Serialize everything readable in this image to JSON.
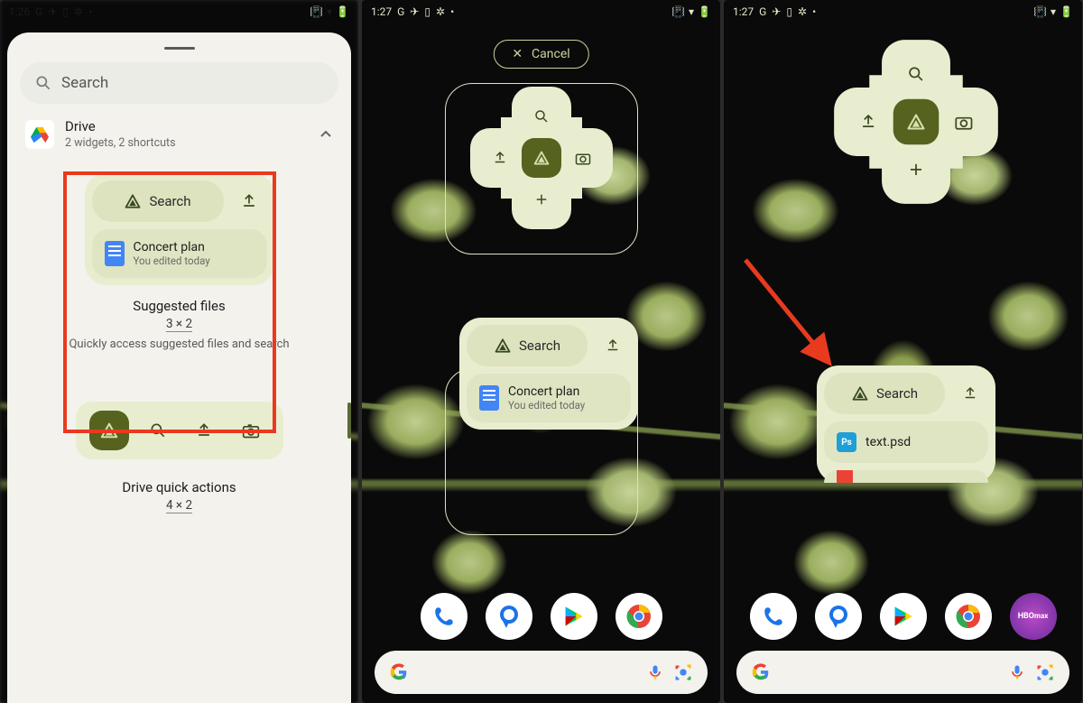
{
  "status": {
    "time_panel1": "1:26",
    "time_panel23": "1:27"
  },
  "panel1": {
    "search_label": "Search",
    "app_title": "Drive",
    "app_subtitle": "2 widgets, 2 shortcuts",
    "widget1": {
      "search_label": "Search",
      "file_title": "Concert plan",
      "file_subtitle": "You edited today",
      "name": "Suggested files",
      "dim": "3 × 2",
      "desc": "Quickly access suggested files and search"
    },
    "widget2": {
      "name": "Drive quick actions",
      "dim": "4 × 2"
    }
  },
  "panel2": {
    "cancel": "Cancel",
    "widget_search": "Search",
    "file_title": "Concert plan",
    "file_subtitle": "You edited today"
  },
  "panel3": {
    "widget_search": "Search",
    "file_title": "text.psd",
    "hbo_label": "HBO\nmax"
  }
}
